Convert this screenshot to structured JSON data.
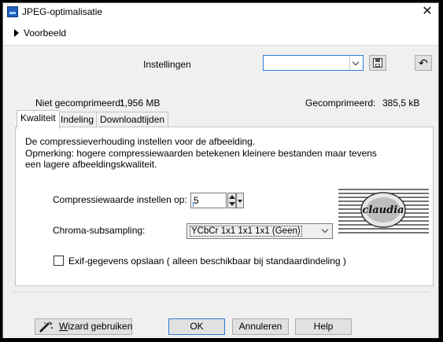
{
  "window": {
    "title": "JPEG-optimalisatie",
    "close_glyph": "✕"
  },
  "preview": {
    "label": "Voorbeeld"
  },
  "settings": {
    "label": "Instellingen",
    "preset_value": "",
    "save_icon": "floppy-disk-icon",
    "reset_icon": "reset-icon",
    "reset_glyph": "↶"
  },
  "stats": {
    "uncompressed_label": "Niet gecomprimeerd:",
    "uncompressed_value": "1,956 MB",
    "compressed_label": "Gecomprimeerd:",
    "compressed_value": "385,5 kB"
  },
  "tabs": [
    {
      "label": "Kwaliteit",
      "active": true
    },
    {
      "label": "Indeling",
      "active": false
    },
    {
      "label": "Downloadtijden",
      "active": false
    }
  ],
  "quality": {
    "description_line1": "De compressieverhouding instellen voor de afbeelding.",
    "description_line2": "Opmerking:  hogere compressiewaarden betekenen kleinere bestanden maar tevens",
    "description_line3": "een lagere afbeeldingskwaliteit.",
    "compression_label": "Compressiewaarde instellen op:",
    "compression_value": "5",
    "chroma_label": "Chroma-subsampling:",
    "chroma_value": "YCbCr  1x1  1x1  1x1  (Geen)",
    "exif_label": "Exif-gegevens opslaan ( alleen beschikbaar bij standaardindeling )",
    "exif_checked": false,
    "watermark_text": "claudia"
  },
  "buttons": {
    "wizard_prefix": "W",
    "wizard_rest": "izard gebruiken",
    "ok": "OK",
    "cancel": "Annuleren",
    "help": "Help"
  },
  "colors": {
    "accent": "#2e7bd6",
    "background": "#f0f0f0"
  }
}
